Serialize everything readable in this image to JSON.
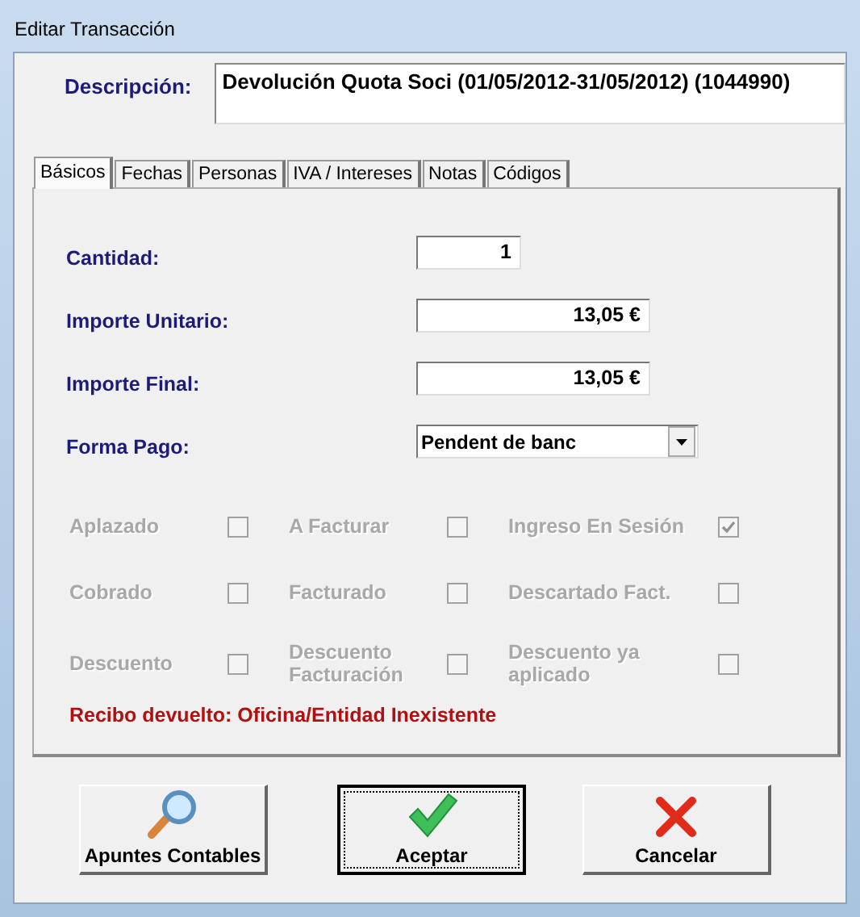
{
  "window": {
    "title": "Editar Transacción"
  },
  "description": {
    "label": "Descripción:",
    "value": "Devolución Quota Soci (01/05/2012-31/05/2012) (1044990)"
  },
  "tabs": [
    {
      "label": "Básicos",
      "selected": true
    },
    {
      "label": "Fechas",
      "selected": false
    },
    {
      "label": "Personas",
      "selected": false
    },
    {
      "label": "IVA / Intereses",
      "selected": false
    },
    {
      "label": "Notas",
      "selected": false
    },
    {
      "label": "Códigos",
      "selected": false
    }
  ],
  "fields": [
    {
      "kind": "text",
      "label": "Cantidad:",
      "value": "1"
    },
    {
      "kind": "text",
      "label": "Importe Unitario:",
      "value": "13,05 €"
    },
    {
      "kind": "text",
      "label": "Importe Final:",
      "value": "13,05 €"
    },
    {
      "kind": "dropdown",
      "label": "Forma Pago:",
      "value": "Pendent de banc"
    }
  ],
  "checkboxes": [
    {
      "label": "Aplazado",
      "checked": false,
      "disabled": true
    },
    {
      "label": "A Facturar",
      "checked": false,
      "disabled": true
    },
    {
      "label": "Ingreso En Sesión",
      "checked": true,
      "disabled": true
    },
    {
      "label": "Cobrado",
      "checked": false,
      "disabled": true
    },
    {
      "label": "Facturado",
      "checked": false,
      "disabled": true
    },
    {
      "label": "Descartado Fact.",
      "checked": false,
      "disabled": true
    },
    {
      "label": "Descuento",
      "checked": false,
      "disabled": true
    },
    {
      "label": "Descuento Facturación",
      "checked": false,
      "disabled": true
    },
    {
      "label": "Descuento ya aplicado",
      "checked": false,
      "disabled": true
    }
  ],
  "warning": "Recibo devuelto: Oficina/Entidad Inexistente",
  "buttons": [
    {
      "kind": "search",
      "label": "Apuntes Contables",
      "default": false
    },
    {
      "kind": "accept",
      "label": "Aceptar",
      "default": true
    },
    {
      "kind": "cancel",
      "label": "Cancelar",
      "default": false
    }
  ]
}
